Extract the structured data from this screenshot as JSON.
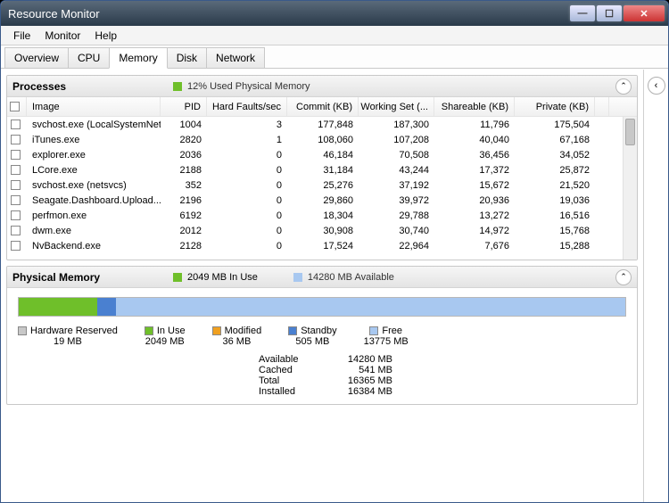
{
  "window": {
    "title": "Resource Monitor"
  },
  "menu": {
    "file": "File",
    "monitor": "Monitor",
    "help": "Help"
  },
  "tabs": {
    "overview": "Overview",
    "cpu": "CPU",
    "memory": "Memory",
    "disk": "Disk",
    "network": "Network"
  },
  "processes": {
    "title": "Processes",
    "status": "12% Used Physical Memory",
    "cols": {
      "image": "Image",
      "pid": "PID",
      "hf": "Hard Faults/sec",
      "commit": "Commit (KB)",
      "ws": "Working Set (...",
      "share": "Shareable (KB)",
      "priv": "Private (KB)"
    },
    "rows": [
      {
        "image": "svchost.exe (LocalSystemNet...",
        "pid": "1004",
        "hf": "3",
        "commit": "177,848",
        "ws": "187,300",
        "share": "11,796",
        "priv": "175,504"
      },
      {
        "image": "iTunes.exe",
        "pid": "2820",
        "hf": "1",
        "commit": "108,060",
        "ws": "107,208",
        "share": "40,040",
        "priv": "67,168"
      },
      {
        "image": "explorer.exe",
        "pid": "2036",
        "hf": "0",
        "commit": "46,184",
        "ws": "70,508",
        "share": "36,456",
        "priv": "34,052"
      },
      {
        "image": "LCore.exe",
        "pid": "2188",
        "hf": "0",
        "commit": "31,184",
        "ws": "43,244",
        "share": "17,372",
        "priv": "25,872"
      },
      {
        "image": "svchost.exe (netsvcs)",
        "pid": "352",
        "hf": "0",
        "commit": "25,276",
        "ws": "37,192",
        "share": "15,672",
        "priv": "21,520"
      },
      {
        "image": "Seagate.Dashboard.Upload...",
        "pid": "2196",
        "hf": "0",
        "commit": "29,860",
        "ws": "39,972",
        "share": "20,936",
        "priv": "19,036"
      },
      {
        "image": "perfmon.exe",
        "pid": "6192",
        "hf": "0",
        "commit": "18,304",
        "ws": "29,788",
        "share": "13,272",
        "priv": "16,516"
      },
      {
        "image": "dwm.exe",
        "pid": "2012",
        "hf": "0",
        "commit": "30,908",
        "ws": "30,740",
        "share": "14,972",
        "priv": "15,768"
      },
      {
        "image": "NvBackend.exe",
        "pid": "2128",
        "hf": "0",
        "commit": "17,524",
        "ws": "22,964",
        "share": "7,676",
        "priv": "15,288"
      }
    ]
  },
  "pm": {
    "title": "Physical Memory",
    "inUse": "2049 MB In Use",
    "available": "14280 MB Available",
    "legend": {
      "hw": {
        "label": "Hardware Reserved",
        "val": "19 MB",
        "color": "#c8c8c8"
      },
      "use": {
        "label": "In Use",
        "val": "2049 MB",
        "color": "#6fbf2a"
      },
      "mod": {
        "label": "Modified",
        "val": "36 MB",
        "color": "#f0a020"
      },
      "sb": {
        "label": "Standby",
        "val": "505 MB",
        "color": "#4a80d0"
      },
      "fr": {
        "label": "Free",
        "val": "13775 MB",
        "color": "#a8c8f0"
      }
    },
    "barSeg": [
      {
        "color": "#6fbf2a",
        "w": "13%"
      },
      {
        "color": "#4a80d0",
        "w": "3%"
      },
      {
        "color": "#a8c8f0",
        "w": "84%"
      }
    ],
    "stats": {
      "available": {
        "l": "Available",
        "v": "14280 MB"
      },
      "cached": {
        "l": "Cached",
        "v": "541 MB"
      },
      "total": {
        "l": "Total",
        "v": "16365 MB"
      },
      "installed": {
        "l": "Installed",
        "v": "16384 MB"
      }
    }
  }
}
